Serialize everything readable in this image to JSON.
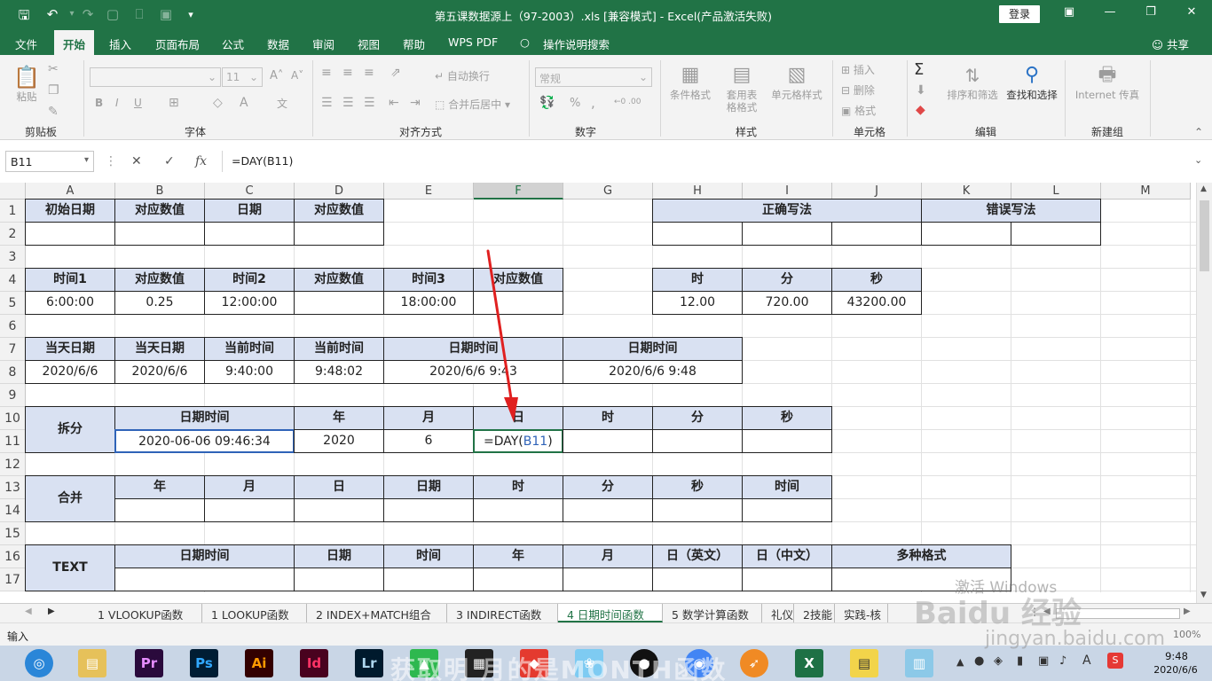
{
  "titlebar": {
    "title": "第五课数据源上（97-2003）.xls  [兼容模式]  -  Excel(产品激活失败)",
    "login": "登录"
  },
  "tabs": [
    "文件",
    "开始",
    "插入",
    "页面布局",
    "公式",
    "数据",
    "审阅",
    "视图",
    "帮助",
    "WPS PDF",
    "操作说明搜索"
  ],
  "share": "共享",
  "ribbon": {
    "clipboard": {
      "paste": "粘贴",
      "label": "剪贴板"
    },
    "font": {
      "font_name": "",
      "font_size": "11",
      "bold": "B",
      "italic": "I",
      "underline": "U",
      "label": "字体"
    },
    "align": {
      "wrap": "自动换行",
      "merge": "合并后居中",
      "label": "对齐方式"
    },
    "number": {
      "format": "常规",
      "pct": "%",
      "comma": ",",
      "label": "数字"
    },
    "styles": {
      "cond": "条件格式",
      "table": "套用表格格式",
      "cell": "单元格样式",
      "label": "样式"
    },
    "cells": {
      "insert": "插入",
      "delete": "删除",
      "format": "格式",
      "label": "单元格"
    },
    "edit": {
      "sort": "排序和筛选",
      "find": "查找和选择",
      "label": "编辑"
    },
    "new_group": {
      "internet": "Internet 传真",
      "label": "新建组"
    }
  },
  "formula": {
    "namebox": "B11",
    "fx": "fx",
    "value": "=DAY(B11)"
  },
  "columns": [
    "A",
    "B",
    "C",
    "D",
    "E",
    "F",
    "G",
    "H",
    "I",
    "J",
    "K",
    "L",
    "M"
  ],
  "selected_col": "F",
  "rows": [
    "1",
    "2",
    "3",
    "4",
    "5",
    "6",
    "7",
    "8",
    "9",
    "10",
    "11",
    "12",
    "13",
    "14",
    "15",
    "16",
    "17"
  ],
  "cells": {
    "r1": {
      "a": "初始日期",
      "b": "对应数值",
      "c": "日期",
      "d": "对应数值",
      "h": "正确写法",
      "k": "错误写法"
    },
    "r4": {
      "a": "时间1",
      "b": "对应数值",
      "c": "时间2",
      "d": "对应数值",
      "e": "时间3",
      "f": "对应数值",
      "h": "时",
      "i": "分",
      "j": "秒"
    },
    "r5": {
      "a": "6:00:00",
      "b": "0.25",
      "c": "12:00:00",
      "e": "18:00:00",
      "h": "12.00",
      "i": "720.00",
      "j": "43200.00"
    },
    "r7": {
      "a": "当天日期",
      "b": "当天日期",
      "c": "当前时间",
      "d": "当前时间",
      "e": "日期时间",
      "g": "日期时间"
    },
    "r8": {
      "a": "2020/6/6",
      "b": "2020/6/6",
      "c": "9:40:00",
      "d": "9:48:02",
      "e": "2020/6/6 9:43",
      "g": "2020/6/6 9:48"
    },
    "r10": {
      "a": "拆分",
      "b": "日期时间",
      "d": "年",
      "e": "月",
      "f": "日",
      "g": "时",
      "h": "分",
      "i": "秒"
    },
    "r11": {
      "b": "2020-06-06 09:46:34",
      "d": "2020",
      "e": "6",
      "f_prefix": "=DAY(",
      "f_ref": "B11",
      "f_suffix": ")"
    },
    "r13": {
      "a": "合并",
      "b": "年",
      "c": "月",
      "d": "日",
      "e": "日期",
      "f": "时",
      "g": "分",
      "h": "秒",
      "i": "时间"
    },
    "r16": {
      "a": "TEXT",
      "b": "日期时间",
      "d": "日期",
      "e": "时间",
      "f": "年",
      "g": "月",
      "h": "日（英文）",
      "i": "日（中文）",
      "j": "多种格式"
    }
  },
  "sheets": [
    "1 VLOOKUP函数",
    "1 LOOKUP函数",
    "2 INDEX+MATCH组合",
    "3 INDIRECT函数",
    "4 日期时间函数",
    "5 数学计算函数",
    "礼仪",
    "2技能",
    "实践-核"
  ],
  "active_sheet": "4 日期时间函数",
  "status": {
    "mode": "输入",
    "zoom": "100%"
  },
  "taskbar": {
    "time": "9:48",
    "date": "2020/6/6",
    "apps": [
      "Pr",
      "Ps",
      "Ai",
      "Id",
      "Lr"
    ]
  },
  "overlay": {
    "caption": "获取明 月的是MONTH函数",
    "watermark": "激活 Windows",
    "baidu": "Baidu 经验",
    "url": "jingyan.baidu.com"
  },
  "colors": {
    "excel_green": "#217346",
    "header_fill": "#d9e1f2",
    "arrow": "#e02020"
  }
}
